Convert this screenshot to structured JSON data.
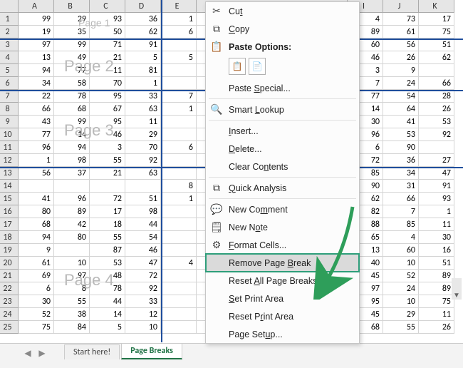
{
  "columns": [
    "A",
    "B",
    "C",
    "D",
    "E",
    "I",
    "J",
    "K"
  ],
  "rows": [
    {
      "r": 1,
      "A": 99,
      "B": 29,
      "C": 93,
      "D": 36,
      "E": 1,
      "I": 4,
      "J": 73,
      "K": 17
    },
    {
      "r": 2,
      "A": 19,
      "B": 35,
      "C": 50,
      "D": 62,
      "E": 6,
      "I": 89,
      "J": 61,
      "K": 75
    },
    {
      "r": 3,
      "A": 97,
      "B": 99,
      "C": 71,
      "D": 91,
      "E": "",
      "I": 60,
      "J": 56,
      "K": 51
    },
    {
      "r": 4,
      "A": 13,
      "B": 49,
      "C": 21,
      "D": 5,
      "E": 5,
      "I": 46,
      "J": 26,
      "K": 62
    },
    {
      "r": 5,
      "A": 94,
      "B": 77,
      "C": 11,
      "D": 81,
      "E": "",
      "I": 3,
      "J": 9,
      "K": ""
    },
    {
      "r": 6,
      "A": 34,
      "B": 58,
      "C": 70,
      "D": 1,
      "E": "",
      "I": 7,
      "J": 24,
      "K": 66
    },
    {
      "r": 7,
      "A": 22,
      "B": 78,
      "C": 95,
      "D": 33,
      "E": 7,
      "I": 77,
      "J": 54,
      "K": 28
    },
    {
      "r": 8,
      "A": 66,
      "B": 68,
      "C": 67,
      "D": 63,
      "E": 1,
      "I": 14,
      "J": 64,
      "K": 26
    },
    {
      "r": 9,
      "A": 43,
      "B": 99,
      "C": 95,
      "D": 11,
      "E": "",
      "I": 30,
      "J": 41,
      "K": 53
    },
    {
      "r": 10,
      "A": 77,
      "B": 14,
      "C": 46,
      "D": 29,
      "E": "",
      "I": 96,
      "J": 53,
      "K": 92
    },
    {
      "r": 11,
      "A": 96,
      "B": 94,
      "C": 3,
      "D": 70,
      "E": 6,
      "I": 6,
      "J": 90,
      "K": ""
    },
    {
      "r": 12,
      "A": 1,
      "B": 98,
      "C": 55,
      "D": 92,
      "E": "",
      "I": 72,
      "J": 36,
      "K": 27
    },
    {
      "r": 13,
      "A": 56,
      "B": 37,
      "C": 21,
      "D": 63,
      "E": "",
      "I": 85,
      "J": 34,
      "K": 47
    },
    {
      "r": 14,
      "A": "",
      "B": "",
      "C": "",
      "D": "",
      "E": 8,
      "I": 90,
      "J": 31,
      "K": 91
    },
    {
      "r": 15,
      "A": 41,
      "B": 96,
      "C": 72,
      "D": 51,
      "E": 1,
      "I": 62,
      "J": 66,
      "K": 93
    },
    {
      "r": 16,
      "A": 80,
      "B": 89,
      "C": 17,
      "D": 98,
      "E": "",
      "I": 82,
      "J": 7,
      "K": 1
    },
    {
      "r": 17,
      "A": 68,
      "B": 42,
      "C": 18,
      "D": 44,
      "E": "",
      "I": 88,
      "J": 85,
      "K": 11
    },
    {
      "r": 18,
      "A": 94,
      "B": 80,
      "C": 55,
      "D": 54,
      "E": "",
      "I": 65,
      "J": 4,
      "K": 30
    },
    {
      "r": 19,
      "A": 9,
      "B": "",
      "C": 87,
      "D": 46,
      "E": "",
      "I": 13,
      "J": 60,
      "K": 16
    },
    {
      "r": 20,
      "A": 61,
      "B": 10,
      "C": 53,
      "D": 47,
      "E": 4,
      "I": 40,
      "J": 10,
      "K": 51
    },
    {
      "r": 21,
      "A": 69,
      "B": 97,
      "C": 48,
      "D": 72,
      "E": "",
      "I": 45,
      "J": 52,
      "K": 89
    },
    {
      "r": 22,
      "A": 6,
      "B": 8,
      "C": 78,
      "D": 92,
      "E": "",
      "I": 97,
      "J": 24,
      "K": 89
    },
    {
      "r": 23,
      "A": 30,
      "B": 55,
      "C": 44,
      "D": 33,
      "E": "",
      "I": 95,
      "J": 10,
      "K": 75
    },
    {
      "r": 24,
      "A": 52,
      "B": 38,
      "C": 14,
      "D": 12,
      "E": "",
      "I": 45,
      "J": 29,
      "K": 11
    },
    {
      "r": 25,
      "A": 75,
      "B": 84,
      "C": 5,
      "D": 10,
      "E": "",
      "I": 68,
      "J": 55,
      "K": 26
    }
  ],
  "watermarks": {
    "p1": "Page 1",
    "p2": "Page 2",
    "p3": "Page 3",
    "p4": "Page 4"
  },
  "tabs": {
    "sheet1": "Start here!",
    "sheet2": "Page Breaks"
  },
  "menu": {
    "cut": "Cut",
    "copy": "Copy",
    "paste_options": "Paste Options:",
    "paste_special": "Paste Special...",
    "smart_lookup": "Smart Lookup",
    "insert": "Insert...",
    "delete": "Delete...",
    "clear": "Clear Contents",
    "quick_analysis": "Quick Analysis",
    "new_comment": "New Comment",
    "new_note": "New Note",
    "format_cells": "Format Cells...",
    "remove_page_break": "Remove Page Break",
    "reset_breaks": "Reset All Page Breaks",
    "set_print_area": "Set Print Area",
    "reset_print_area": "Reset Print Area",
    "page_setup": "Page Setup..."
  },
  "chart_data": null
}
